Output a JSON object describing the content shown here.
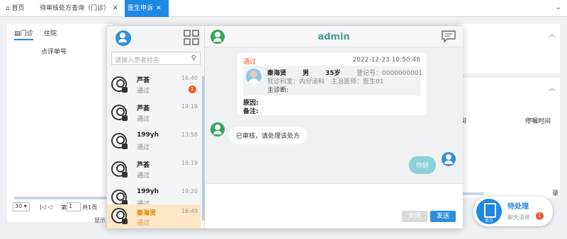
{
  "tabs": [
    {
      "label": "首页",
      "close": ""
    },
    {
      "label": "待审核处方查询（门诊）",
      "close": "✕"
    },
    {
      "label": "医生申诉",
      "close": "✕"
    }
  ],
  "collapse_icon": "chevron-down",
  "left_panel": {
    "subtabs": [
      "门诊",
      "住院"
    ],
    "column": "点评单号",
    "page_size": "30",
    "page_label": "第",
    "page_value": "1",
    "page_total": "共1页",
    "footer_text": "显示"
  },
  "right_panel": {
    "col1": "间",
    "col2": "停嘱时间",
    "tail": "录"
  },
  "contacts": {
    "search_placeholder": "请输入患者姓名",
    "list": [
      {
        "name": "芦荟",
        "status": "通过",
        "time": "16:40",
        "badge": "1"
      },
      {
        "name": "芦荟",
        "status": "通过",
        "time": "19:19",
        "badge": ""
      },
      {
        "name": "199yh",
        "status": "通过",
        "time": "13:58",
        "badge": ""
      },
      {
        "name": "芦荟",
        "status": "通过",
        "time": "19:19",
        "badge": ""
      },
      {
        "name": "199yh",
        "status": "通过",
        "time": "19:20",
        "badge": ""
      },
      {
        "name": "秦海贤",
        "status": "通过",
        "time": "16:49",
        "badge": ""
      }
    ]
  },
  "chat": {
    "title": "admin",
    "card": {
      "status": "通过",
      "datetime": "2022-12-23 10:50:48",
      "patient_name": "秦海贤",
      "gender": "男",
      "age": "35岁",
      "reg_no": "登记号：0000000001",
      "dept": "就诊科室：内分泌科",
      "doctor": "主治医师：医生01",
      "diagnosis": "主诊断:",
      "reason": "原因:",
      "remark": "备注:"
    },
    "msg_in": "已审核，请处理该处方",
    "msg_out": "你好",
    "close_label": "关闭",
    "send_label": "发送"
  },
  "pending": {
    "icon_label": "审方",
    "title": "待处理",
    "subtitle": "聊天消息",
    "badge": "1"
  }
}
